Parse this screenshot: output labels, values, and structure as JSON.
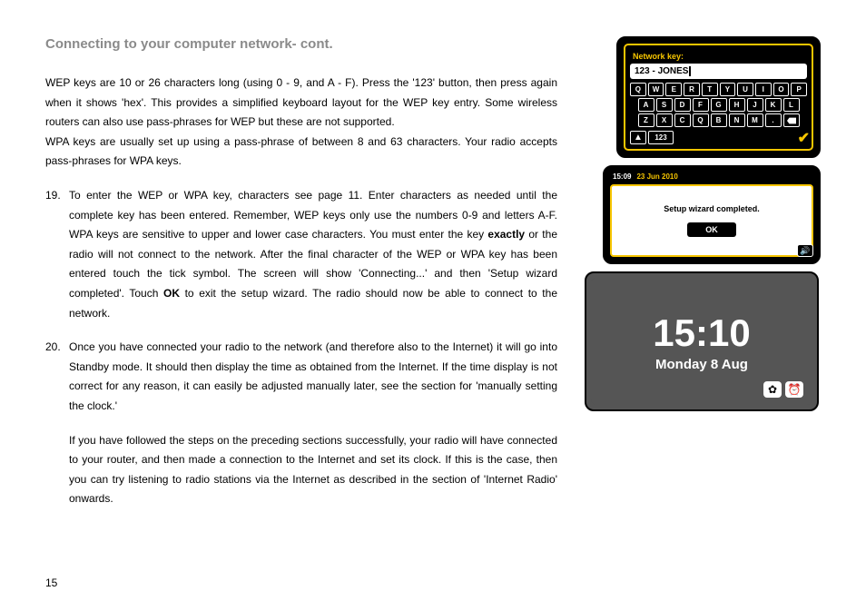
{
  "heading": "Connecting to your computer network- cont.",
  "para1": "WEP keys are 10 or 26 characters long (using 0 - 9, and A - F). Press the '123' button, then press again when it shows 'hex'. This provides a simplified keyboard layout for the WEP key entry. Some wireless routers can also use pass-phrases for WEP but these are not supported.",
  "para2": "WPA keys are usually set up using a pass-phrase of between 8 and 63 characters. Your radio accepts pass-phrases for WPA keys.",
  "item19_num": "19.",
  "item19_a": "To enter the WEP or WPA key, characters see page 11. Enter characters as needed until the complete key has been entered. Remember, WEP keys only use the numbers 0-9 and letters A-F. WPA keys are sensitive to upper and lower case characters. You must enter the key ",
  "item19_bold": "exactly",
  "item19_b": " or the radio will not connect to the network. After the final character of the WEP or WPA key has been entered touch the tick symbol. The screen will show 'Connecting...' and then 'Setup wizard completed'. Touch ",
  "item19_bold2": "OK",
  "item19_c": " to exit the setup wizard. The radio should now be able to connect to the network.",
  "item20_num": "20.",
  "item20_a": "Once you have connected your radio to the network (and therefore also to the Internet) it will go into Standby mode. It should then display the time as obtained from the Internet. If the time display is not correct for any reason, it can easily be adjusted manually later, see the section for 'manually setting the clock.'",
  "item20_b": "If you have followed the steps on the preceding sections successfully, your radio will have connected to your router, and then made a connection to the Internet and set its clock. If this is the case, then you can try listening to radio stations via the Internet as described in the section of 'Internet Radio' onwards.",
  "page_number": "15",
  "kb": {
    "label": "Network key:",
    "input": "123 - JONES",
    "row1": [
      "Q",
      "W",
      "E",
      "R",
      "T",
      "Y",
      "U",
      "I",
      "O",
      "P"
    ],
    "row2": [
      "A",
      "S",
      "D",
      "F",
      "G",
      "H",
      "J",
      "K",
      "L"
    ],
    "row3": [
      "Z",
      "X",
      "C",
      "Q",
      "B",
      "N",
      "M",
      "."
    ],
    "mode_key": "123",
    "tick": "✔"
  },
  "setup": {
    "time": "15:09",
    "date": "23 Jun 2010",
    "message": "Setup wizard completed.",
    "ok": "OK"
  },
  "clock": {
    "time": "15:10",
    "date": "Monday 8 Aug"
  },
  "icons": {
    "speaker": "🔊",
    "gear": "✿",
    "alarm": "⏰"
  }
}
